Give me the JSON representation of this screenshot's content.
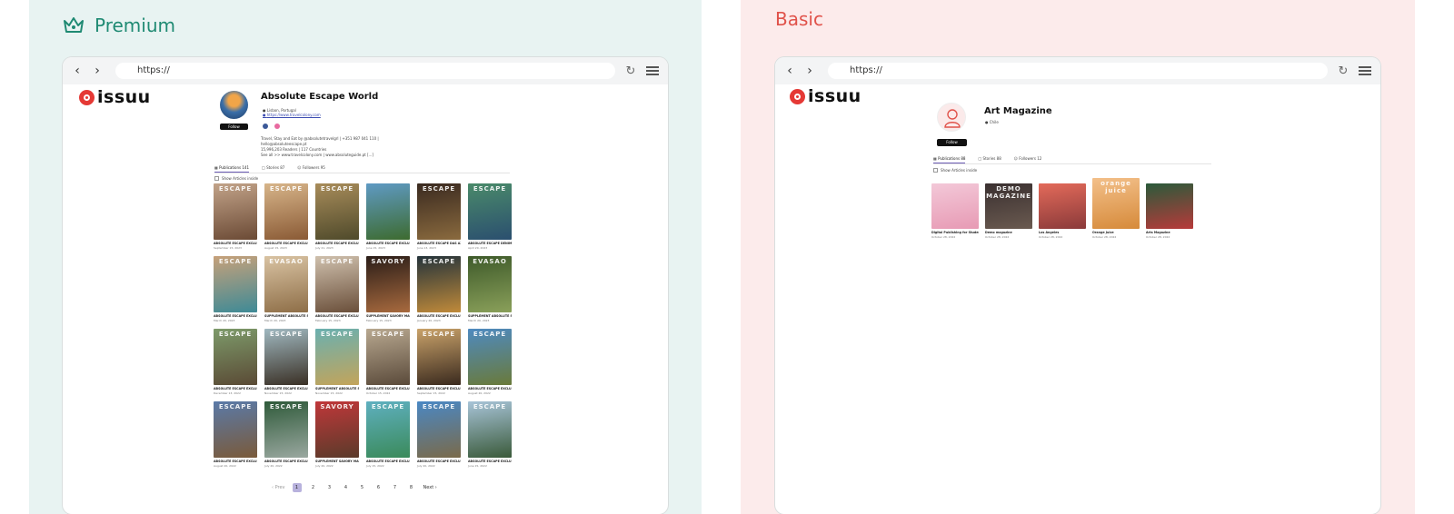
{
  "premium": {
    "plan_label": "Premium",
    "url": "https://",
    "logo_text": "issuu",
    "profile": {
      "name": "Absolute Escape World",
      "location": "Lisbon, Portugal",
      "website": "https://www.travelcolony.com",
      "follow_label": "Follow",
      "bio_lines": [
        "Travel, Stay and Eat by @absolutetravelgrl | +351 987 041 110 |",
        "hello@absoluteescape.pt",
        "15,996,203 Readers | 117 Countries",
        "See all >> www.travelcolony.com | www.absoluteguide.pt [...]"
      ]
    },
    "tabs": [
      "Publications 141",
      "Stories 87",
      "Followers 95"
    ],
    "checkbox_label": "Show Articles inside",
    "covers": [
      {
        "mast": "ESCAPE",
        "title": "ABSOLUTE ESCAPE EXCLUSI...",
        "date": "September 15, 2023",
        "c1": "#c2a389",
        "c2": "#6b4a35"
      },
      {
        "mast": "ESCAPE",
        "title": "ABSOLUTE ESCAPE EXCLUSI...",
        "date": "August 15, 2023",
        "c1": "#d7b58a",
        "c2": "#8a5a35"
      },
      {
        "mast": "ESCAPE",
        "title": "ABSOLUTE ESCAPE EXCLUSI...",
        "date": "July 21, 2023",
        "c1": "#a88c5a",
        "c2": "#4f4a2b"
      },
      {
        "mast": "",
        "title": "ABSOLUTE ESCAPE EXCLUSI...",
        "date": "June 15, 2023",
        "c1": "#5f9ac4",
        "c2": "#3d6b2f"
      },
      {
        "mast": "ESCAPE",
        "title": "ABSOLUTE ESCAPE DAS AZE...",
        "date": "June 13, 2023",
        "c1": "#3a2a20",
        "c2": "#8a6a3e"
      },
      {
        "mast": "ESCAPE",
        "title": "ABSOLUTE ESCAPE DENIM B...",
        "date": "April 20, 2023",
        "c1": "#4a8a6a",
        "c2": "#2b4f6f"
      },
      {
        "mast": "ESCAPE",
        "title": "ABSOLUTE ESCAPE EXCLUSI...",
        "date": "March 20, 2023",
        "c1": "#c7a17a",
        "c2": "#3e8a96"
      },
      {
        "mast": "EVASAO",
        "title": "SUPPLEMENT ABSOLUTE S...",
        "date": "March 20, 2023",
        "c1": "#d9c3a3",
        "c2": "#8e6e47"
      },
      {
        "mast": "ESCAPE",
        "title": "ABSOLUTE ESCAPE EXCLUSI...",
        "date": "February 15, 2023",
        "c1": "#cfc0ad",
        "c2": "#6a4f3a"
      },
      {
        "mast": "SAVORY",
        "title": "SUPPLEMENT SAVORY MAG...",
        "date": "February 15, 2023",
        "c1": "#2a1d18",
        "c2": "#a86a3e"
      },
      {
        "mast": "ESCAPE",
        "title": "ABSOLUTE ESCAPE EXCLUSI...",
        "date": "January 20, 2023",
        "c1": "#24333b",
        "c2": "#c08a3a"
      },
      {
        "mast": "EVASAO",
        "title": "SUPPLEMENT ABSOLUTE S...",
        "date": "March 20, 2023",
        "c1": "#3e5a2a",
        "c2": "#8aa05a"
      },
      {
        "mast": "ESCAPE",
        "title": "ABSOLUTE ESCAPE EXCLUSI...",
        "date": "December 13, 2022",
        "c1": "#7d9a6a",
        "c2": "#5a4a35"
      },
      {
        "mast": "ESCAPE",
        "title": "ABSOLUTE ESCAPE EXCLUSI...",
        "date": "November 15, 2022",
        "c1": "#a0b8c0",
        "c2": "#3a3025"
      },
      {
        "mast": "ESCAPE",
        "title": "SUPPLEMENT ABSOLUTE S...",
        "date": "November 15, 2022",
        "c1": "#6ab0b0",
        "c2": "#c3a45a"
      },
      {
        "mast": "ESCAPE",
        "title": "ABSOLUTE ESCAPE EXCLUSI...",
        "date": "October 15, 2022",
        "c1": "#b8a890",
        "c2": "#5a4a3a"
      },
      {
        "mast": "ESCAPE",
        "title": "ABSOLUTE ESCAPE EXCLUSI...",
        "date": "September 15, 2022",
        "c1": "#c9a26a",
        "c2": "#3a2a1e"
      },
      {
        "mast": "ESCAPE",
        "title": "ABSOLUTE ESCAPE EXCLUSI...",
        "date": "August 20, 2022",
        "c1": "#4e8ac0",
        "c2": "#6a7a3a"
      },
      {
        "mast": "ESCAPE",
        "title": "ABSOLUTE ESCAPE EXCLUSI...",
        "date": "August 20, 2022",
        "c1": "#5a7aa8",
        "c2": "#7a5a3a"
      },
      {
        "mast": "ESCAPE",
        "title": "ABSOLUTE ESCAPE EXCLUSI...",
        "date": "July 20, 2022",
        "c1": "#2f5a3a",
        "c2": "#9aa8a0"
      },
      {
        "mast": "SAVORY",
        "title": "SUPPLEMENT SAVORY MAG...",
        "date": "July 20, 2022",
        "c1": "#c0383a",
        "c2": "#5a3a2a"
      },
      {
        "mast": "ESCAPE",
        "title": "ABSOLUTE ESCAPE EXCLUSI...",
        "date": "July 15, 2022",
        "c1": "#5fb0c0",
        "c2": "#3a8a5a"
      },
      {
        "mast": "ESCAPE",
        "title": "ABSOLUTE ESCAPE EXCLUSI...",
        "date": "July 20, 2022",
        "c1": "#4a88c4",
        "c2": "#7a6a4a"
      },
      {
        "mast": "ESCAPE",
        "title": "ABSOLUTE ESCAPE EXCLUSI...",
        "date": "June 15, 2022",
        "c1": "#a8c4d8",
        "c2": "#3a5a3a"
      }
    ],
    "pagination": {
      "prev": "Prev",
      "pages": [
        "1",
        "2",
        "3",
        "4",
        "5",
        "6",
        "7",
        "8"
      ],
      "next": "Next"
    }
  },
  "basic": {
    "plan_label": "Basic",
    "url": "https://",
    "logo_text": "issuu",
    "profile": {
      "name": "Art Magazine",
      "location": "Chile",
      "follow_label": "Follow"
    },
    "tabs": [
      "Publications 88",
      "Stories 88",
      "Followers 12"
    ],
    "checkbox_label": "Show Articles inside",
    "covers": [
      {
        "mast": "",
        "title": "Digital Publishing for Student...",
        "date": "October 28, 2022",
        "c1": "#f3c8d8",
        "c2": "#e79ab4"
      },
      {
        "mast": "DEMO MAGAZINE",
        "title": "Demo magazine",
        "date": "October 28, 2022",
        "c1": "#3a3030",
        "c2": "#6a5a50"
      },
      {
        "mast": "",
        "title": "Los Angeles",
        "date": "October 28, 2022",
        "c1": "#e36a5a",
        "c2": "#8a3a3a"
      },
      {
        "mast": "orange juice",
        "title": "Orange Juice",
        "date": "October 28, 2022",
        "c1": "#f3c08a",
        "c2": "#d68a3a"
      },
      {
        "mast": "",
        "title": "Arts Magazine",
        "date": "October 28, 2022",
        "c1": "#2a5a3a",
        "c2": "#b83a3a"
      }
    ]
  }
}
